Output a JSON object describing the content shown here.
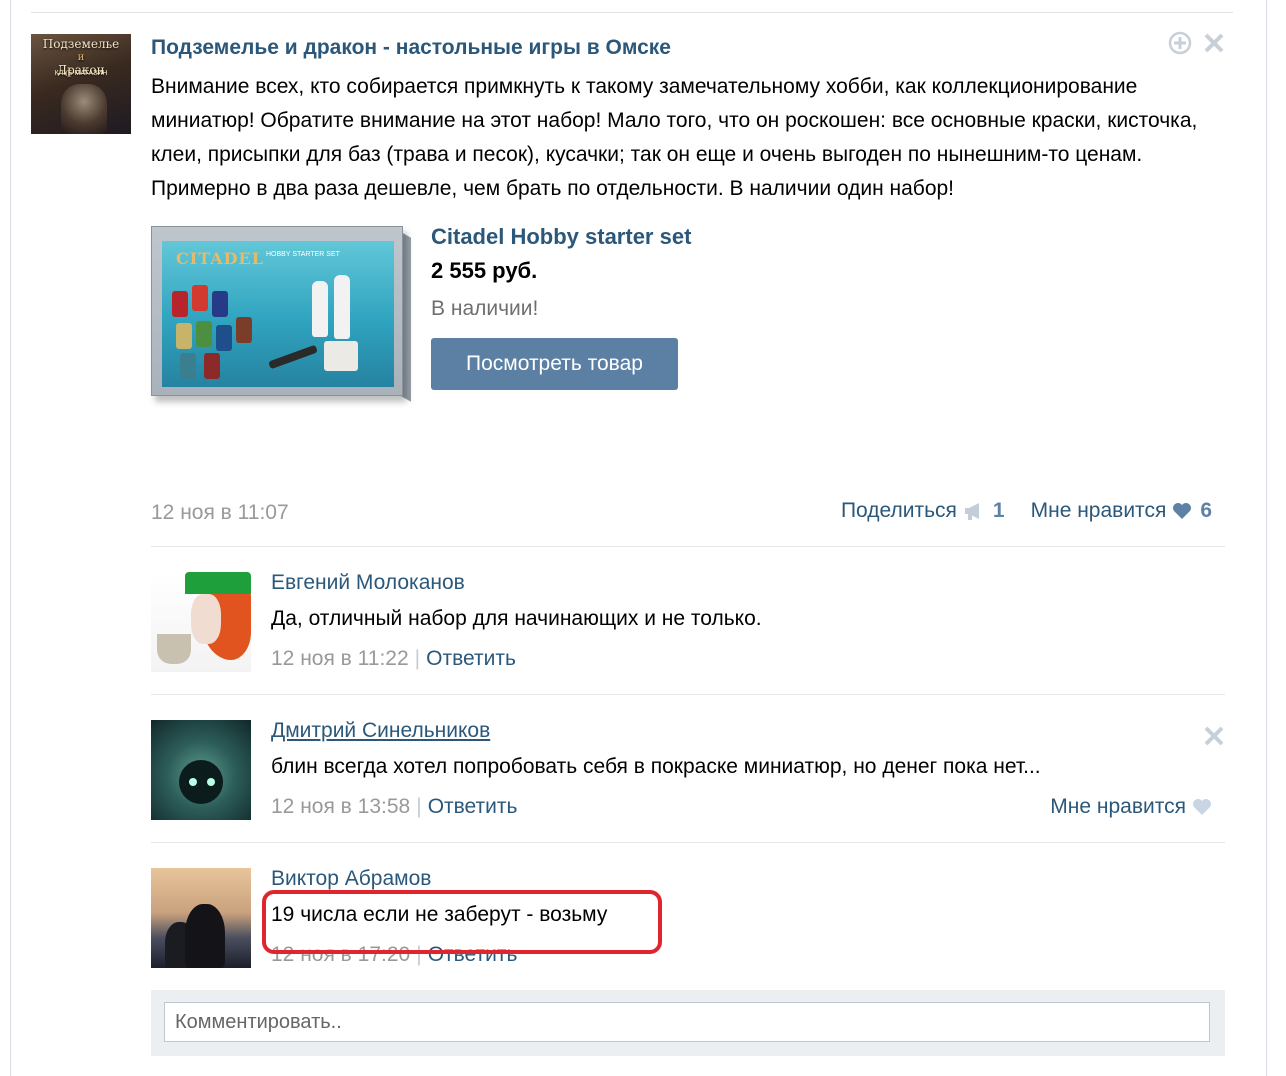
{
  "post": {
    "group_name": "Подземелье и дракон - настольные игры в Омске",
    "avatar_text": {
      "line1": "Подземелье",
      "line2": "и",
      "line3": "Дракон",
      "line4": "КЛУБ-МАГАЗИН"
    },
    "text": "Внимание всех, кто собирается примкнуть к такому замечательному хобби, как коллекционирование миниатюр! Обратите внимание на этот набор! Мало того, что он роскошен: все основные краски, кисточка, клеи, присыпки для баз (трава и песок), кусачки; так он еще и очень выгоден по нынешним-то ценам. Примерно в два раза дешевле, чем брать по отдельности. В наличии один набор!",
    "date": "12 ноя в 11:07",
    "share_label": "Поделиться",
    "share_count": "1",
    "like_label": "Мне нравится",
    "like_count": "6"
  },
  "product": {
    "brand_on_box": "CITADEL",
    "box_caption": "HOBBY STARTER SET",
    "name": "Citadel Hobby starter set",
    "price": "2 555 руб.",
    "availability": "В наличии!",
    "button_label": "Посмотреть товар"
  },
  "comments": [
    {
      "author": "Евгений Молоканов",
      "text": "Да, отличный набор для начинающих и не только.",
      "date": "12 ноя в 11:22",
      "reply_label": "Ответить"
    },
    {
      "author": "Дмитрий Синельников",
      "text": "блин всегда хотел попробовать себя в покраске миниатюр, но денег пока нет...",
      "date": "12 ноя в 13:58",
      "reply_label": "Ответить",
      "like_label": "Мне нравится"
    },
    {
      "author": "Виктор Абрамов",
      "text": "19 числа если не заберут - возьму",
      "date": "12 ноя в 17:20",
      "reply_label": "Ответить"
    }
  ],
  "comment_box": {
    "placeholder": "Комментировать.."
  },
  "colors": {
    "link": "#2b587a",
    "button": "#5c80a3",
    "muted": "#999999",
    "highlight": "#e0252f",
    "heart": "#5e81a8"
  },
  "icons": [
    "report-icon",
    "close-icon",
    "megaphone-icon",
    "heart-icon"
  ]
}
